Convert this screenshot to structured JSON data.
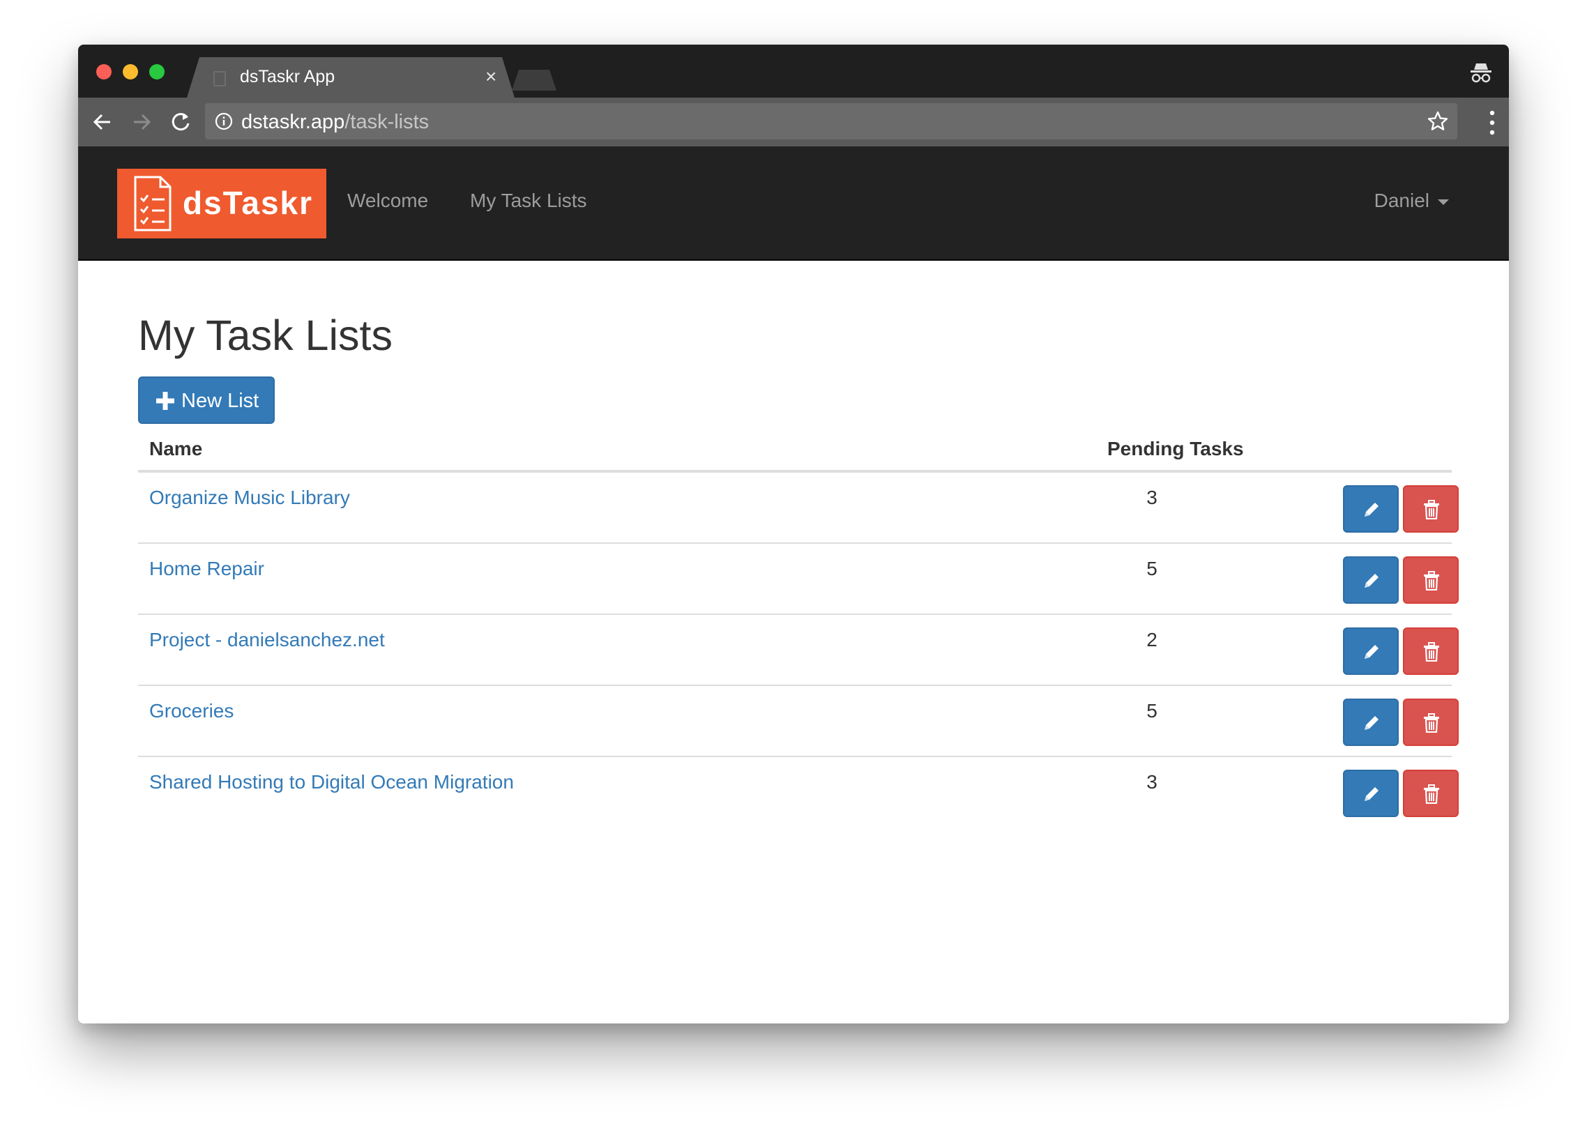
{
  "browser": {
    "tab_title": "dsTaskr App",
    "tab_close": "×",
    "url_host": "dstaskr.app",
    "url_path": "/task-lists",
    "icons": [
      "back-icon",
      "forward-icon",
      "reload-icon",
      "info-icon",
      "star-icon",
      "menu-icon",
      "incognito-icon"
    ]
  },
  "app_nav": {
    "brand": "dsTaskr",
    "links": [
      "Welcome",
      "My Task Lists"
    ],
    "user": "Daniel",
    "brand_color": "#ef5a2f",
    "bar_color": "#222222"
  },
  "main": {
    "title": "My Task Lists",
    "new_button": "New List",
    "columns": {
      "name": "Name",
      "pending": "Pending Tasks"
    },
    "rows": [
      {
        "name": "Organize Music Library",
        "pending": "3"
      },
      {
        "name": "Home Repair",
        "pending": "5"
      },
      {
        "name": "Project - danielsanchez.net",
        "pending": "2"
      },
      {
        "name": "Groceries",
        "pending": "5"
      },
      {
        "name": "Shared Hosting to Digital Ocean Migration",
        "pending": "3"
      }
    ],
    "colors": {
      "primary": "#337ab7",
      "danger": "#d9534f",
      "link": "#337ab7"
    }
  }
}
